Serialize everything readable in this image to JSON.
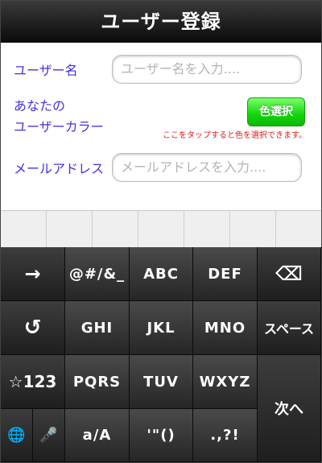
{
  "nav": {
    "title": "ユーザー登録"
  },
  "form": {
    "username_label": "ユーザー名",
    "username_placeholder": "ユーザー名を入力....",
    "color_label_line1": "あなたの",
    "color_label_line2": "ユーザーカラー",
    "color_button": "色選択",
    "color_hint": "ここをタップすると色を選択できます。",
    "email_label": "メールアドレス",
    "email_placeholder": "メールアドレスを入力...."
  },
  "keyboard": {
    "row1": {
      "arrow": "→",
      "symbols": "@#/&_",
      "abc": "ABC",
      "def": "DEF",
      "backspace": "⌫"
    },
    "row2": {
      "undo": "↺",
      "ghi": "GHI",
      "jkl": "JKL",
      "mno": "MNO",
      "space": "スペース"
    },
    "row3": {
      "num": "☆123",
      "pqrs": "PQRS",
      "tuv": "TUV",
      "wxyz": "WXYZ",
      "next": "次へ"
    },
    "row4": {
      "globe": "🌐",
      "mic": "🎤",
      "case": "a/A",
      "quotes": "'\"()",
      "punct": ".,?!"
    }
  }
}
